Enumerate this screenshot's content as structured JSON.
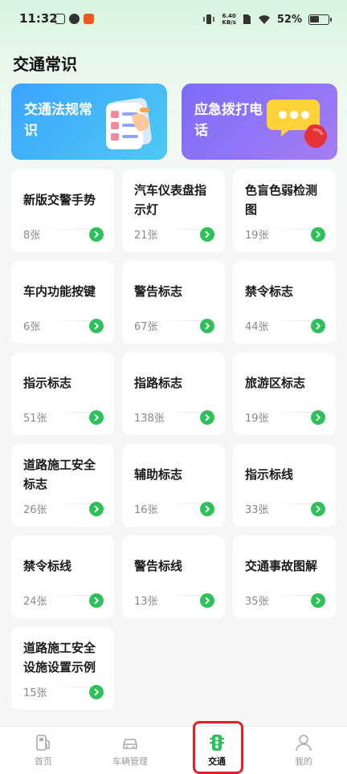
{
  "status_bar": {
    "time": "11:32",
    "network_speed_value": "6.40",
    "network_speed_unit": "KB/s",
    "battery_percent": "52%",
    "battery_level": 0.52
  },
  "page": {
    "title": "交通常识"
  },
  "banners": [
    {
      "label": "交通法规常识",
      "color_from": "#3ba4ff",
      "color_to": "#4fc9f2"
    },
    {
      "label": "应急拨打电话",
      "color_from": "#7b6cf6",
      "color_to": "#a67df5"
    }
  ],
  "categories": [
    {
      "name": "新版交警手势",
      "count": "8张"
    },
    {
      "name": "汽车仪表盘指示灯",
      "count": "21张"
    },
    {
      "name": "色盲色弱检测图",
      "count": "19张"
    },
    {
      "name": "车内功能按键",
      "count": "6张"
    },
    {
      "name": "警告标志",
      "count": "67张"
    },
    {
      "name": "禁令标志",
      "count": "44张"
    },
    {
      "name": "指示标志",
      "count": "51张"
    },
    {
      "name": "指路标志",
      "count": "138张"
    },
    {
      "name": "旅游区标志",
      "count": "19张"
    },
    {
      "name": "道路施工安全标志",
      "count": "26张"
    },
    {
      "name": "辅助标志",
      "count": "16张"
    },
    {
      "name": "指示标线",
      "count": "33张"
    },
    {
      "name": "禁令标线",
      "count": "24张"
    },
    {
      "name": "警告标线",
      "count": "13张"
    },
    {
      "name": "交通事故图解",
      "count": "35张"
    },
    {
      "name": "道路施工安全设施设置示例",
      "count": "15张"
    }
  ],
  "bottom_nav": [
    {
      "label": "首页",
      "icon": "fuel-pump-icon",
      "active": false
    },
    {
      "label": "车辆管理",
      "icon": "car-icon",
      "active": false
    },
    {
      "label": "交通",
      "icon": "traffic-light-icon",
      "active": true
    },
    {
      "label": "我的",
      "icon": "person-icon",
      "active": false
    }
  ],
  "colors": {
    "accent_green": "#2ec15b",
    "highlight_red": "#e0232b"
  }
}
